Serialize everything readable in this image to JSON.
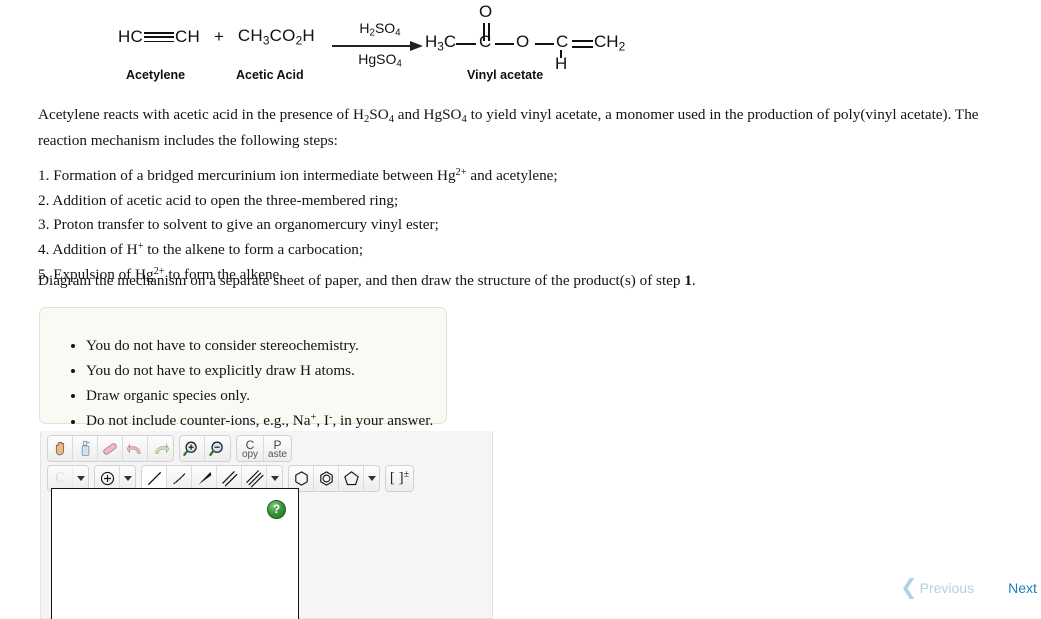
{
  "reaction": {
    "reactant1": {
      "formula_pre": "HC",
      "formula_post": "CH",
      "name": "Acetylene"
    },
    "plus": "+",
    "reactant2": {
      "formula": "CH3CO2H",
      "name": "Acetic Acid"
    },
    "reagent_above": "H2SO4",
    "reagent_below": "HgSO4",
    "product": {
      "name": "Vinyl acetate",
      "atom_o_top": "O",
      "atom_h3c": "H3C",
      "atom_c_center": "C",
      "atom_o_ester": "O",
      "atom_c_vinyl": "C",
      "atom_h_below": "H",
      "atom_ch2": "CH2"
    }
  },
  "body": {
    "paragraph_a": "Acetylene reacts with acetic acid in the presence of H",
    "paragraph_b": "SO",
    "paragraph_c": " and HgSO",
    "paragraph_d": " to yield vinyl acetate, a monomer used in the production of poly(vinyl acetate). The reaction mechanism includes the following steps:",
    "steps": [
      {
        "num": "1.",
        "text_a": "Formation of a bridged mercurinium ion intermediate between Hg",
        "sup": "2+",
        "text_b": " and acetylene;"
      },
      {
        "num": "2.",
        "text_a": "Addition of acetic acid to open the three-membered ring;",
        "sup": "",
        "text_b": ""
      },
      {
        "num": "3.",
        "text_a": "Proton transfer to solvent to give an organomercury vinyl ester;",
        "sup": "",
        "text_b": ""
      },
      {
        "num": "4.",
        "text_a": "Addition of H",
        "sup": "+",
        "text_b": " to the alkene to form a carbocation;"
      },
      {
        "num": "5.",
        "text_a": "Expulsion of Hg",
        "sup": "2+",
        "text_b": " to form the alkene."
      }
    ],
    "instruction_a": "Diagram the mechanism on a separate sheet of paper, and then draw the structure of the product(s) of step ",
    "instruction_bold": "1",
    "instruction_end": "."
  },
  "notes": [
    {
      "text_a": "You do not have to consider stereochemistry.",
      "sup": "",
      "text_b": "",
      "sup2": "",
      "text_c": ""
    },
    {
      "text_a": "You do not have to explicitly draw H atoms.",
      "sup": "",
      "text_b": "",
      "sup2": "",
      "text_c": ""
    },
    {
      "text_a": "Draw organic species only.",
      "sup": "",
      "text_b": "",
      "sup2": "",
      "text_c": ""
    },
    {
      "text_a": "Do not include counter-ions, e.g., Na",
      "sup": "+",
      "text_b": ", I",
      "sup2": "-",
      "text_c": ", in your answer."
    }
  ],
  "editor": {
    "toolbar_row1": [
      {
        "name": "pan-hand-tool",
        "glyph": "hand"
      },
      {
        "name": "clear-spray-tool",
        "glyph": "spray"
      },
      {
        "name": "eraser-tool",
        "glyph": "eraser"
      },
      {
        "name": "undo-tool",
        "glyph": "undo"
      },
      {
        "name": "redo-tool",
        "glyph": "redo"
      },
      {
        "name": "zoom-in-tool",
        "glyph": "zoom-in"
      },
      {
        "name": "zoom-out-tool",
        "glyph": "zoom-out"
      },
      {
        "name": "copy-tool",
        "glyph": "copy",
        "label_main": "C",
        "label_sub": "opy"
      },
      {
        "name": "paste-tool",
        "glyph": "paste",
        "label_main": "P",
        "label_sub": "aste"
      }
    ],
    "element_label": "C",
    "charge_label": "charge",
    "bracket_label": "[ ]",
    "bracket_sup": "±",
    "help_label": "?"
  },
  "nav": {
    "previous_label": "Previous",
    "next_label": "Next",
    "chevron_left": "❮",
    "chevron_right": "❯",
    "previous_color": "#aed4e8",
    "next_color": "#1f7fb5"
  }
}
